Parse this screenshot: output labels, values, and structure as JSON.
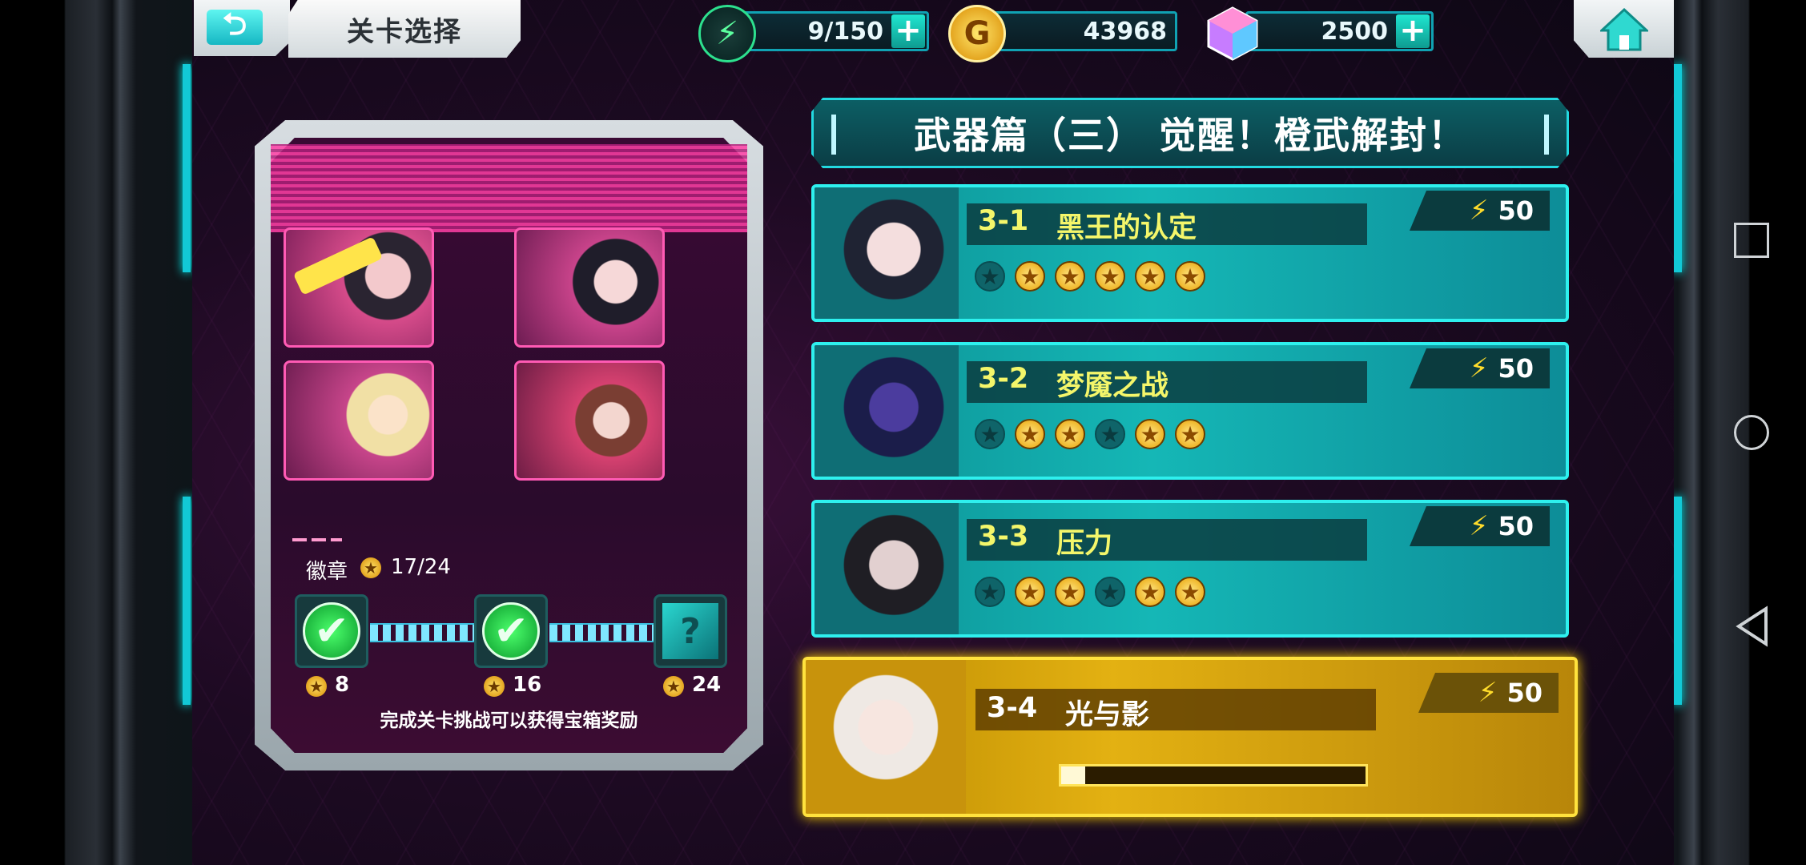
{
  "topbar": {
    "back_icon": "back-arrow-icon",
    "title": "关卡选择",
    "energy": {
      "icon": "lightning-icon",
      "value": "9/150"
    },
    "gold": {
      "icon": "gold-coin-icon",
      "glyph": "G",
      "value": "43968"
    },
    "gems": {
      "icon": "gem-icon",
      "value": "2500"
    },
    "plus": "+",
    "home_icon": "home-icon"
  },
  "reward_panel": {
    "badge_label": "徽章",
    "badge_count": "17/24",
    "badge_progress": 0.7083,
    "rewards": [
      {
        "threshold": "8",
        "state": "claimed"
      },
      {
        "threshold": "16",
        "state": "claimed"
      },
      {
        "threshold": "24",
        "state": "locked"
      }
    ],
    "check_glyph": "✔",
    "mystery_glyph": "?",
    "star_glyph": "★",
    "note": "完成关卡挑战可以获得宝箱奖励"
  },
  "chapter": {
    "title": "武器篇（三）  觉醒！橙武解封！"
  },
  "stages": [
    {
      "id": "3-1",
      "name": "黑王的认定",
      "cost": "50",
      "stars": [
        0,
        1,
        1,
        1,
        1,
        1
      ]
    },
    {
      "id": "3-2",
      "name": "梦魇之战",
      "cost": "50",
      "stars": [
        0,
        1,
        1,
        0,
        1,
        1
      ]
    },
    {
      "id": "3-3",
      "name": "压力",
      "cost": "50",
      "stars": [
        0,
        1,
        1,
        0,
        1,
        1
      ]
    },
    {
      "id": "3-4",
      "name": "光与影",
      "cost": "50",
      "progress": 0.08,
      "selected": true
    }
  ],
  "stage_labels": {
    "bolt": "⚡"
  },
  "colors": {
    "accent_cyan": "#2ef0ee",
    "accent_pink": "#ff3fa5",
    "gold": "#ffe23d"
  }
}
